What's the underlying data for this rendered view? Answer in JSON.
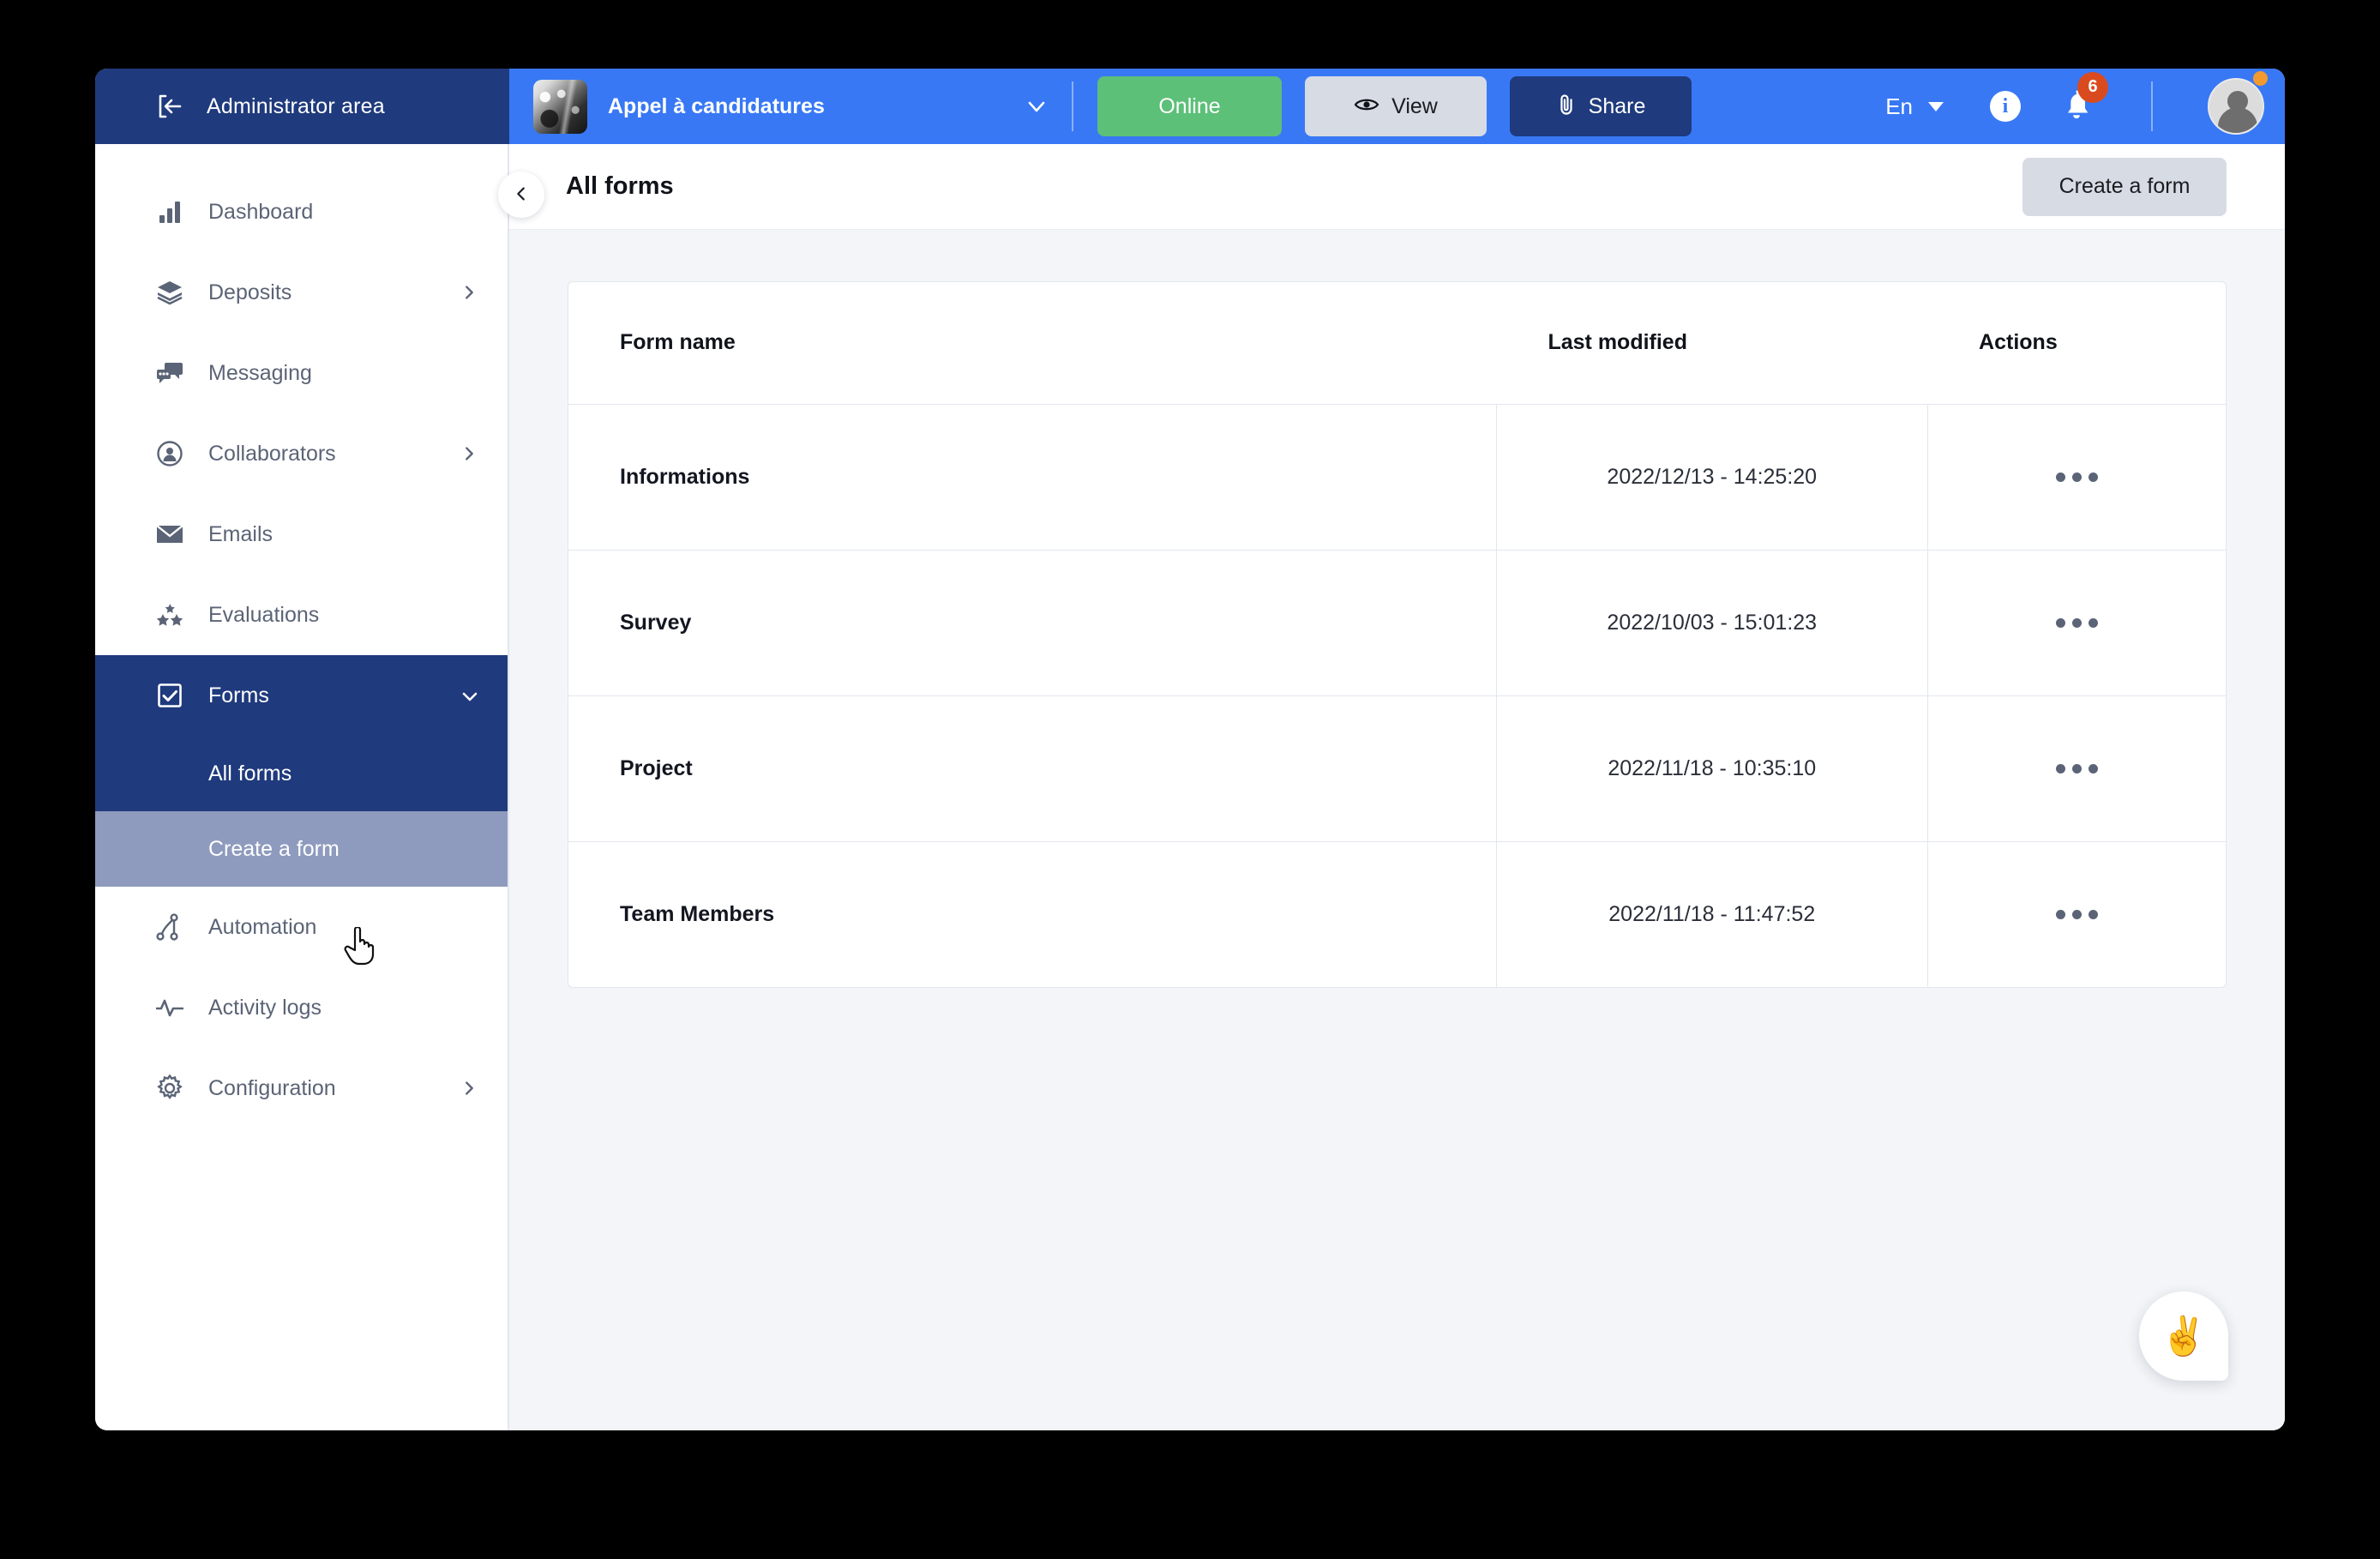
{
  "topbar": {
    "admin_label": "Administrator area",
    "admin_icon": "logout-arrow-icon",
    "project_name": "Appel à candidatures",
    "project_dropdown_icon": "chevron-down-icon",
    "online_label": "Online",
    "view_label": "View",
    "view_icon": "eye-icon",
    "share_label": "Share",
    "share_icon": "paperclip-icon",
    "language": "En",
    "info_icon": "info-icon",
    "info_glyph": "i",
    "bell_icon": "bell-icon",
    "notification_count": "6",
    "avatar_icon": "user-avatar-icon"
  },
  "sidebar": {
    "collapse_icon": "chevron-left-icon",
    "items": [
      {
        "label": "Dashboard",
        "icon": "bar-chart-icon",
        "has_chevron": false,
        "active": false
      },
      {
        "label": "Deposits",
        "icon": "layers-icon",
        "has_chevron": true,
        "active": false
      },
      {
        "label": "Messaging",
        "icon": "chat-icon",
        "has_chevron": false,
        "active": false
      },
      {
        "label": "Collaborators",
        "icon": "user-circle-icon",
        "has_chevron": true,
        "active": false
      },
      {
        "label": "Emails",
        "icon": "envelope-icon",
        "has_chevron": false,
        "active": false
      },
      {
        "label": "Evaluations",
        "icon": "stars-icon",
        "has_chevron": false,
        "active": false
      },
      {
        "label": "Forms",
        "icon": "checkbox-icon",
        "has_chevron": true,
        "active": true
      },
      {
        "label": "Automation",
        "icon": "node-graph-icon",
        "has_chevron": false,
        "active": false
      },
      {
        "label": "Activity logs",
        "icon": "pulse-icon",
        "has_chevron": false,
        "active": false
      },
      {
        "label": "Configuration",
        "icon": "gear-icon",
        "has_chevron": true,
        "active": false
      }
    ],
    "forms_subitems": [
      {
        "label": "All forms",
        "selected": false
      },
      {
        "label": "Create a form",
        "selected": true
      }
    ]
  },
  "main": {
    "page_title": "All forms",
    "create_button": "Create a form",
    "table": {
      "columns": [
        "Form name",
        "Last modified",
        "Actions"
      ],
      "actions_icon": "ellipsis-horizontal-icon",
      "rows": [
        {
          "name": "Informations",
          "modified": "2022/12/13 - 14:25:20"
        },
        {
          "name": "Survey",
          "modified": "2022/10/03 - 15:01:23"
        },
        {
          "name": "Project",
          "modified": "2022/11/18 - 10:35:10"
        },
        {
          "name": "Team Members",
          "modified": "2022/11/18 - 11:47:52"
        }
      ]
    },
    "chat_fab_icon": "victory-hand-emoji",
    "chat_fab_glyph": "✌️"
  },
  "colors": {
    "navy": "#1F3A7D",
    "header_blue": "#3878F5",
    "green": "#5CC078",
    "light_gray_button": "#D7DBE4",
    "selected_subitem": "#8E9BBE",
    "badge_orange": "#D94B1E",
    "content_bg": "#F3F5F8"
  }
}
